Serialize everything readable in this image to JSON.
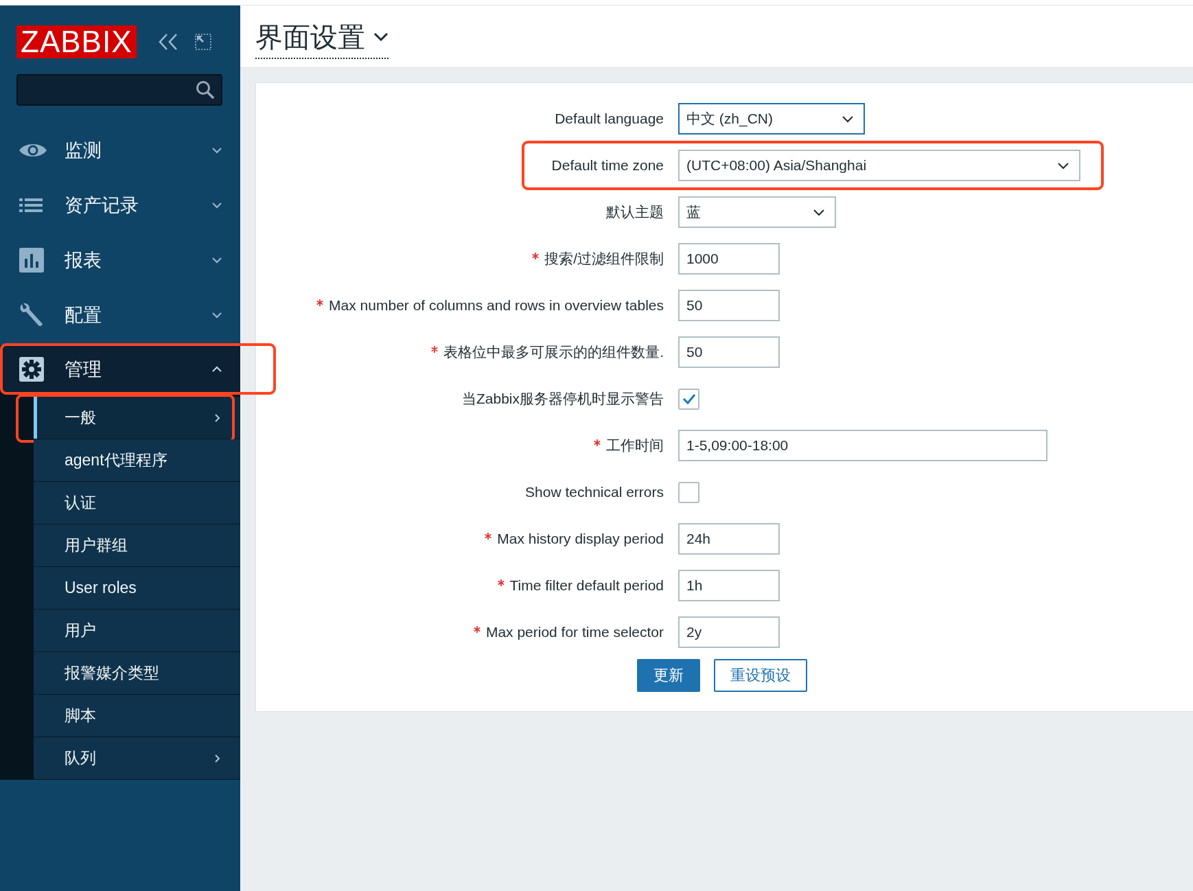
{
  "sidebar": {
    "logo": "ZABBIX",
    "menu": [
      {
        "label": "监测",
        "expanded": false,
        "highlighted": false
      },
      {
        "label": "资产记录",
        "expanded": false,
        "highlighted": false
      },
      {
        "label": "报表",
        "expanded": false,
        "highlighted": false
      },
      {
        "label": "配置",
        "expanded": false,
        "highlighted": false
      },
      {
        "label": "管理",
        "expanded": true,
        "highlighted": true,
        "children": [
          {
            "label": "一般",
            "selected": true,
            "has_submenu": true,
            "highlighted": true
          },
          {
            "label": "agent代理程序",
            "selected": false,
            "has_submenu": false,
            "highlighted": false
          },
          {
            "label": "认证",
            "selected": false,
            "has_submenu": false,
            "highlighted": false
          },
          {
            "label": "用户群组",
            "selected": false,
            "has_submenu": false,
            "highlighted": false
          },
          {
            "label": "User roles",
            "selected": false,
            "has_submenu": false,
            "highlighted": false
          },
          {
            "label": "用户",
            "selected": false,
            "has_submenu": false,
            "highlighted": false
          },
          {
            "label": "报警媒介类型",
            "selected": false,
            "has_submenu": false,
            "highlighted": false
          },
          {
            "label": "脚本",
            "selected": false,
            "has_submenu": false,
            "highlighted": false
          },
          {
            "label": "队列",
            "selected": false,
            "has_submenu": true,
            "highlighted": false
          }
        ]
      }
    ]
  },
  "page_title": "界面设置",
  "form": {
    "rows": [
      {
        "label": "Default language",
        "required": false,
        "kind": "select",
        "value": "中文 (zh_CN)",
        "highlighted": false
      },
      {
        "label": "Default time zone",
        "required": false,
        "kind": "select",
        "value": "(UTC+08:00) Asia/Shanghai",
        "highlighted": true
      },
      {
        "label": "默认主题",
        "required": false,
        "kind": "select",
        "value": "蓝",
        "highlighted": false
      },
      {
        "label": "搜索/过滤组件限制",
        "required": true,
        "kind": "text",
        "value": "1000",
        "highlighted": false
      },
      {
        "label": "Max number of columns and rows in overview tables",
        "required": true,
        "kind": "text",
        "value": "50",
        "highlighted": false
      },
      {
        "label": "表格位中最多可展示的的组件数量.",
        "required": true,
        "kind": "text",
        "value": "50",
        "highlighted": false
      },
      {
        "label": "当Zabbix服务器停机时显示警告",
        "required": false,
        "kind": "checkbox",
        "checked": true,
        "highlighted": false
      },
      {
        "label": "工作时间",
        "required": true,
        "kind": "text",
        "value": "1-5,09:00-18:00",
        "highlighted": false
      },
      {
        "label": "Show technical errors",
        "required": false,
        "kind": "checkbox",
        "checked": false,
        "highlighted": false
      },
      {
        "label": "Max history display period",
        "required": true,
        "kind": "text",
        "value": "24h",
        "highlighted": false
      },
      {
        "label": "Time filter default period",
        "required": true,
        "kind": "text",
        "value": "1h",
        "highlighted": false
      },
      {
        "label": "Max period for time selector",
        "required": true,
        "kind": "text",
        "value": "2y",
        "highlighted": false
      }
    ],
    "buttons": [
      {
        "label": "更新",
        "kind": "primary"
      },
      {
        "label": "重设预设",
        "kind": "secondary"
      }
    ]
  }
}
